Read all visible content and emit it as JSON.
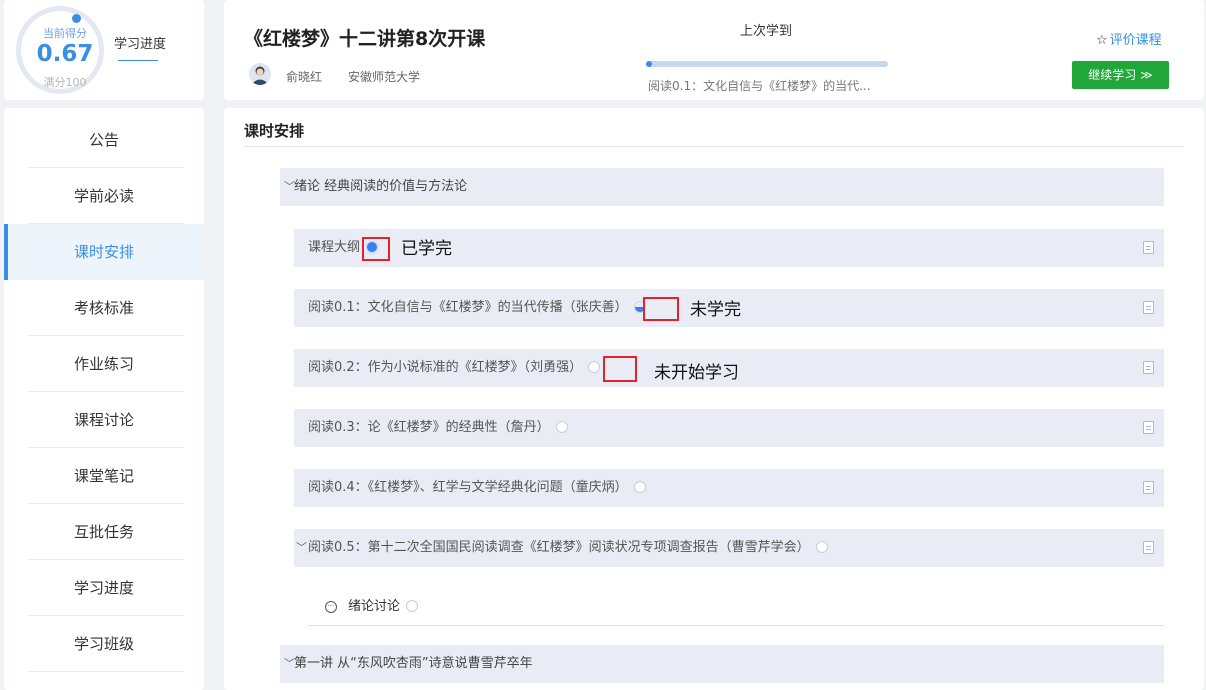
{
  "score": {
    "top_label": "当前得分",
    "value": "0.67",
    "bottom_label": "满分100",
    "progress_link": "学习进度"
  },
  "sidebar": {
    "items": [
      {
        "label": "公告"
      },
      {
        "label": "学前必读"
      },
      {
        "label": "课时安排"
      },
      {
        "label": "考核标准"
      },
      {
        "label": "作业练习"
      },
      {
        "label": "课程讨论"
      },
      {
        "label": "课堂笔记"
      },
      {
        "label": "互批任务"
      },
      {
        "label": "学习进度"
      },
      {
        "label": "学习班级"
      }
    ]
  },
  "header": {
    "title": "《红楼梦》十二讲第8次开课",
    "teacher": "俞晓红",
    "school": "安徽师范大学",
    "last_label": "上次学到",
    "last_item": "阅读0.1：文化自信与《红楼梦》的当代...",
    "last_progress": 0.02,
    "rate_star": "☆",
    "rate_label": "评价课程",
    "continue_label": "继续学习 ≫"
  },
  "main": {
    "title": "课时安排",
    "chapter1": "绪论 经典阅读的价值与方法论",
    "lessons": [
      {
        "label": "课程大纲",
        "status": "done"
      },
      {
        "label": "阅读0.1：文化自信与《红楼梦》的当代传播（张庆善）",
        "status": "half"
      },
      {
        "label": "阅读0.2：作为小说标准的《红楼梦》（刘勇强）",
        "status": "none"
      },
      {
        "label": "阅读0.3：论《红楼梦》的经典性（詹丹）",
        "status": "none"
      },
      {
        "label": "阅读0.4：《红楼梦》、红学与文学经典化问题（童庆炳）",
        "status": "none"
      },
      {
        "label": "阅读0.5：第十二次全国国民阅读调查《红楼梦》阅读状况专项调查报告（曹雪芹学会）",
        "status": "none"
      }
    ],
    "discussion": "绪论讨论",
    "chapter2": "第一讲 从“东风吹杏雨”诗意说曹雪芹卒年"
  },
  "annotations": {
    "done": "已学完",
    "half": "未学完",
    "none": "未开始学习"
  },
  "colors": {
    "accent": "#3a8ee6",
    "continue_button": "#21a639",
    "highlight_box": "#e0242a"
  }
}
